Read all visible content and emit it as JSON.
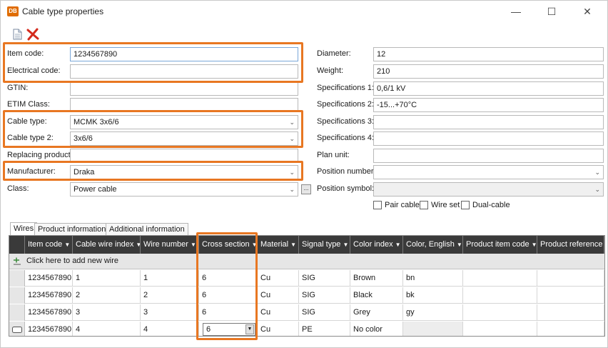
{
  "window": {
    "app_icon_text": "DB",
    "title": "Cable type properties",
    "minimize": "—",
    "maximize": "☐",
    "close": "✕"
  },
  "toolbar": {
    "new_icon": "document-icon",
    "delete_icon": "red-x-icon"
  },
  "left_form": {
    "item_code": {
      "label": "Item code:",
      "value": "1234567890"
    },
    "electrical_code": {
      "label": "Electrical code:",
      "value": ""
    },
    "gtin": {
      "label": "GTIN:",
      "value": ""
    },
    "etim_class": {
      "label": "ETIM Class:",
      "value": ""
    },
    "cable_type": {
      "label": "Cable type:",
      "value": "MCMK 3x6/6"
    },
    "cable_type_2": {
      "label": "Cable type 2:",
      "value": "3x6/6"
    },
    "replacing_product": {
      "label": "Replacing product:",
      "value": ""
    },
    "manufacturer": {
      "label": "Manufacturer:",
      "value": "Draka"
    },
    "class": {
      "label": "Class:",
      "value": "Power cable",
      "browse": "..."
    }
  },
  "right_form": {
    "diameter": {
      "label": "Diameter:",
      "value": "12"
    },
    "weight": {
      "label": "Weight:",
      "value": "210"
    },
    "spec1": {
      "label": "Specifications 1:",
      "value": "0,6/1 kV"
    },
    "spec2": {
      "label": "Specifications 2:",
      "value": "-15...+70°C"
    },
    "spec3": {
      "label": "Specifications 3:",
      "value": ""
    },
    "spec4": {
      "label": "Specifications 4:",
      "value": ""
    },
    "plan_unit": {
      "label": "Plan unit:",
      "value": ""
    },
    "position_number": {
      "label": "Position number:",
      "value": ""
    },
    "position_symbol": {
      "label": "Position symbol:",
      "value": ""
    }
  },
  "checkboxes": {
    "pair_cable": {
      "label": "Pair cable",
      "checked": false
    },
    "wire_set": {
      "label": "Wire set",
      "checked": false
    },
    "dual_cable": {
      "label": "Dual-cable",
      "checked": false
    }
  },
  "tabs": [
    "Wires",
    "Product information",
    "Additional information"
  ],
  "grid": {
    "columns": [
      "Item code",
      "Cable wire index",
      "Wire number",
      "Cross section",
      "Material",
      "Signal type",
      "Color index",
      "Color, English",
      "Product item code",
      "Product reference"
    ],
    "filter_glyph": "▼",
    "add_row_text": "Click here to add new wire",
    "rows": [
      [
        "1234567890",
        "1",
        "1",
        "6",
        "Cu",
        "SIG",
        "Brown",
        "bn",
        "",
        ""
      ],
      [
        "1234567890",
        "2",
        "2",
        "6",
        "Cu",
        "SIG",
        "Black",
        "bk",
        "",
        ""
      ],
      [
        "1234567890",
        "3",
        "3",
        "6",
        "Cu",
        "SIG",
        "Grey",
        "gy",
        "",
        ""
      ],
      [
        "1234567890",
        "4",
        "4",
        "6",
        "Cu",
        "PE",
        "No color",
        "",
        "",
        ""
      ]
    ]
  },
  "colors": {
    "highlight": "#e87722",
    "grid_header": "#3a3a3a",
    "delete_icon": "#d42a1c"
  }
}
